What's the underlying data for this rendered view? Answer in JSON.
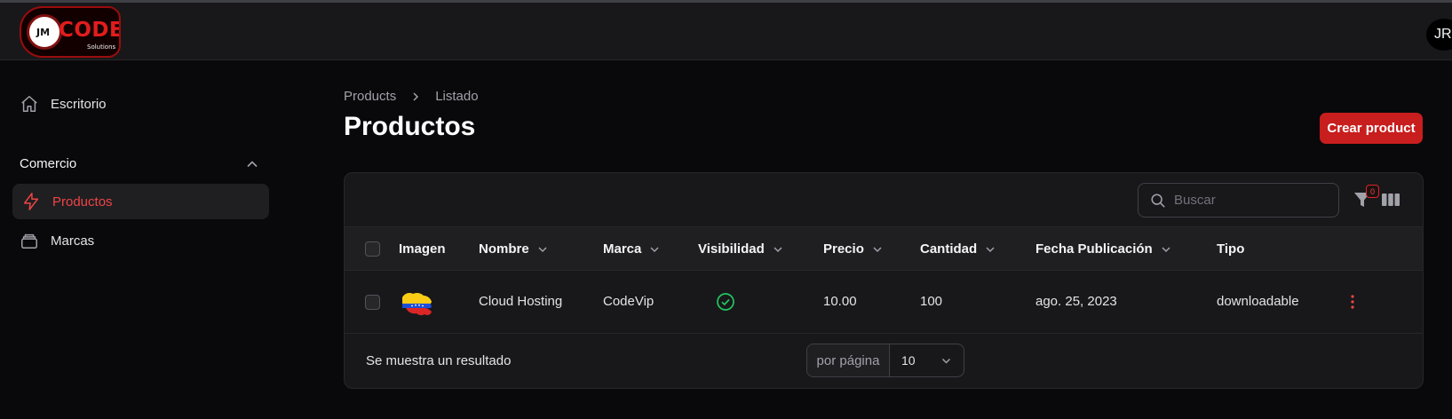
{
  "header": {
    "logo_text": "CODE",
    "logo_badge": "JM",
    "logo_sub": "Solutions",
    "avatar_initials": "JR"
  },
  "sidebar": {
    "escritorio": "Escritorio",
    "group_label": "Comercio",
    "items": [
      {
        "label": "Productos",
        "active": true,
        "icon": "bolt-icon"
      },
      {
        "label": "Marcas",
        "active": false,
        "icon": "stack-icon"
      }
    ]
  },
  "breadcrumb": [
    "Products",
    "Listado"
  ],
  "page": {
    "title": "Productos",
    "create_label": "Crear product"
  },
  "toolbar": {
    "search_placeholder": "Buscar",
    "filter_count": "0"
  },
  "table": {
    "columns": [
      "Imagen",
      "Nombre",
      "Marca",
      "Visibilidad",
      "Precio",
      "Cantidad",
      "Fecha Publicación",
      "Tipo"
    ],
    "rows": [
      {
        "image": "venezuela-map-flag",
        "nombre": "Cloud Hosting",
        "marca": "CodeVip",
        "visibilidad": "check-circle-icon",
        "precio": "10.00",
        "cantidad": "100",
        "fecha": "ago. 25, 2023",
        "tipo": "downloadable"
      }
    ]
  },
  "footer": {
    "result_text": "Se muestra un resultado",
    "per_page_label": "por página",
    "per_page_value": "10"
  },
  "colors": {
    "accent": "#c81e1e",
    "active_text": "#ef4444",
    "success": "#22c55e"
  }
}
